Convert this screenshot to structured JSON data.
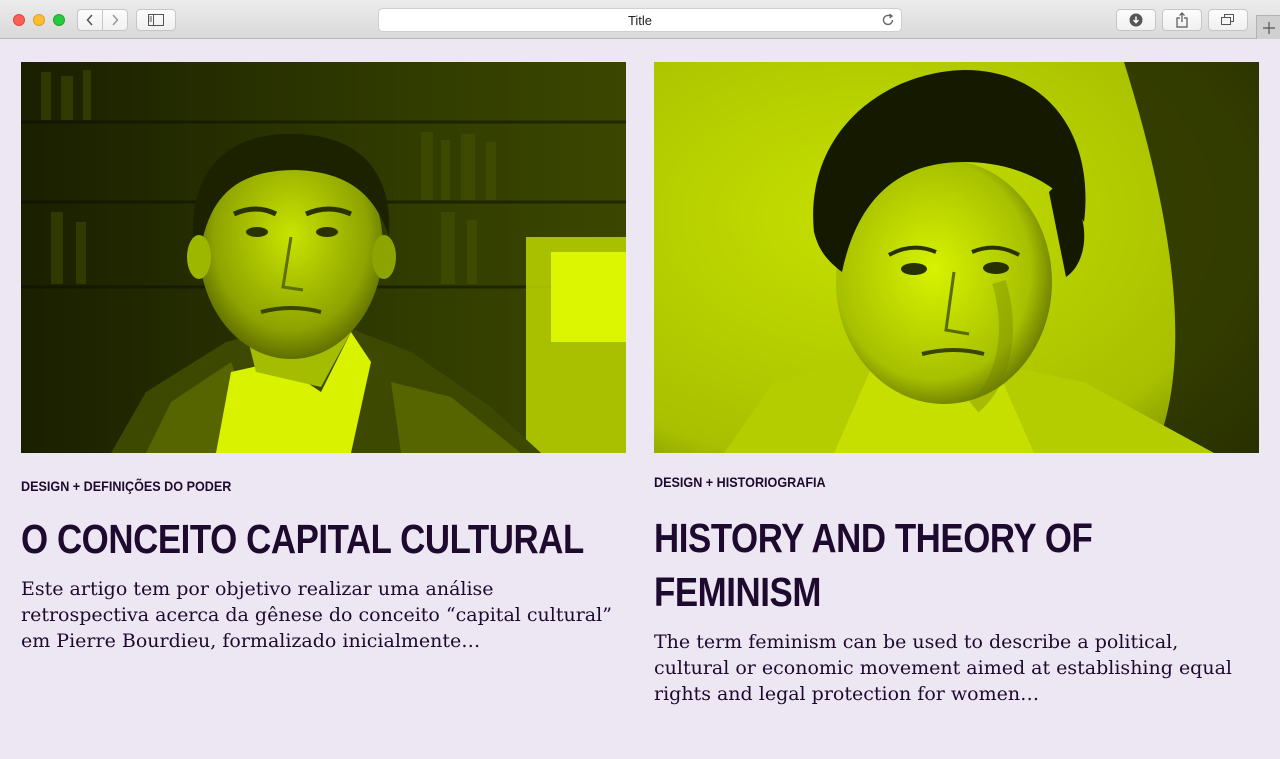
{
  "browser": {
    "title": "Title"
  },
  "articles": [
    {
      "category": "DESIGN + DEFINIÇÕES DO PODER",
      "headline": "O CONCEITO CAPITAL CULTURAL",
      "excerpt": "Este artigo tem por objetivo realizar uma análise retrospectiva acerca da gênese   do conceito “capital cultural” em Pierre Bourdieu, formalizado inicialmente…"
    },
    {
      "category": "DESIGN + HISTORIOGRAFIA",
      "headline": "HISTORY AND THEORY OF FEMINISM",
      "excerpt": "The term feminism can be used to describe a political, cultural or economic movement aimed at establishing equal rights and legal protection for women…"
    }
  ],
  "colors": {
    "background": "#ede7f3",
    "text": "#1e0a2e",
    "photo_tint": "#d4f000"
  }
}
